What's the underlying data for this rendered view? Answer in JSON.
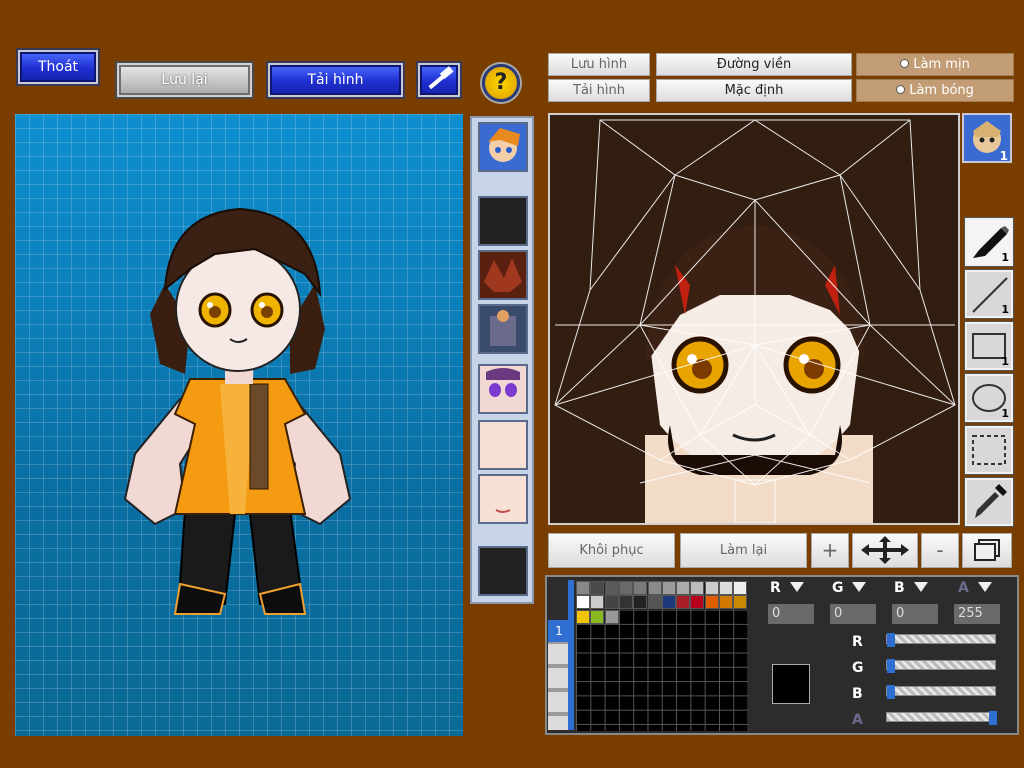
{
  "toolbar": {
    "exit_label": "Thoát",
    "save_label": "Lưu lại",
    "load_label": "Tải hình",
    "build_icon": "hammer-icon",
    "help_icon": "question-icon"
  },
  "editor": {
    "save_image": "Lưu hình",
    "load_image": "Tải hình",
    "outline": "Đường viền",
    "default": "Mặc định",
    "smooth": "Làm mịn",
    "shade": "Làm bóng",
    "restore": "Khôi phục",
    "redo": "Làm lại",
    "zoom_in": "+",
    "zoom_out": "-"
  },
  "layer_badge": "1",
  "tool_badges": [
    "1",
    "1",
    "1",
    "1"
  ],
  "color": {
    "labels": {
      "r": "R",
      "g": "G",
      "b": "B",
      "a": "A"
    },
    "values": {
      "r": "0",
      "g": "0",
      "b": "0",
      "a": "255"
    },
    "levels": {
      "r": 0,
      "g": 0,
      "b": 0,
      "a": 1
    },
    "current": "#000000",
    "tab_label": "1",
    "swatches": [
      "#888888",
      "#4a4a4a",
      "#5a5a5a",
      "#6a6a6a",
      "#7a7a7a",
      "#8a8a8a",
      "#9a9a9a",
      "#aaaaaa",
      "#bbbbbb",
      "#cccccc",
      "#dddddd",
      "#eeeeee",
      "#ffffff",
      "#cccccc",
      "#444444",
      "#333333",
      "#222222",
      "#555555",
      "#1c3a7a",
      "#a71e26",
      "#b8001d",
      "#e05c00",
      "#d07800",
      "#c78a00",
      "#f0c400",
      "#8ab820",
      "#999999"
    ]
  },
  "colors": {
    "background": "#7a3d00",
    "accent_blue": "#1f2fd0"
  }
}
